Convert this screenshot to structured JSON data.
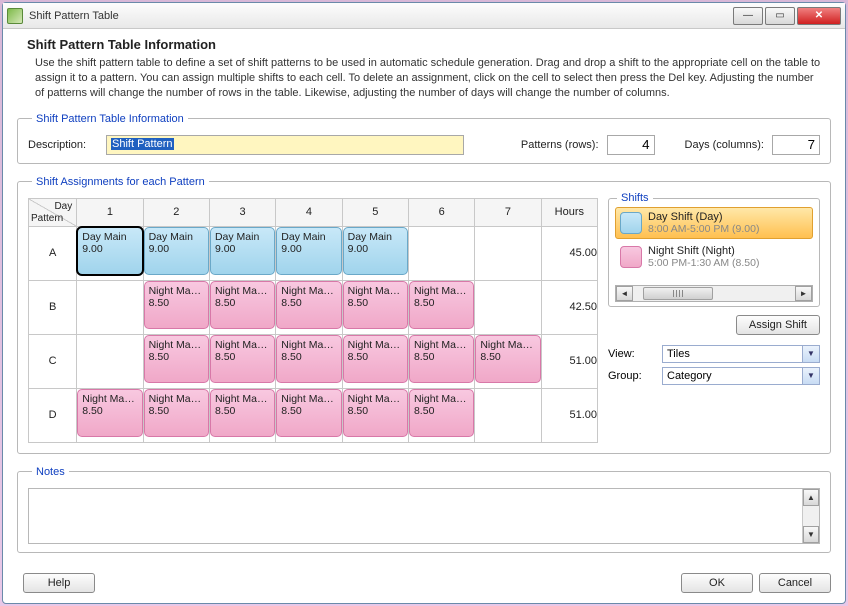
{
  "window": {
    "title": "Shift Pattern Table"
  },
  "header": {
    "title": "Shift Pattern Table Information",
    "desc": "Use the shift pattern table to define a set of shift patterns to be used in automatic schedule generation. Drag and drop a shift to the appropriate cell on the table to assign it to a pattern. You can assign multiple shifts to each cell. To delete an assignment, click on the cell to select then press the Del key.  Adjusting the number of patterns will change the number of rows in the table. Likewise, adjusting the number of days will change the number of columns."
  },
  "info": {
    "legend": "Shift Pattern Table Information",
    "desc_label": "Description:",
    "desc_value": "Shift Pattern",
    "patterns_label": "Patterns (rows):",
    "patterns_value": "4",
    "days_label": "Days (columns):",
    "days_value": "7"
  },
  "assign": {
    "legend": "Shift Assignments for each Pattern",
    "corner_day": "Day",
    "corner_pattern": "Pattern",
    "day_headers": [
      "1",
      "2",
      "3",
      "4",
      "5",
      "6",
      "7"
    ],
    "hours_header": "Hours",
    "rows": [
      {
        "label": "A",
        "hours": "45.00",
        "cells": [
          {
            "t": "day",
            "l1": "Day Main",
            "l2": "9.00",
            "sel": true
          },
          {
            "t": "day",
            "l1": "Day Main",
            "l2": "9.00"
          },
          {
            "t": "day",
            "l1": "Day Main",
            "l2": "9.00"
          },
          {
            "t": "day",
            "l1": "Day Main",
            "l2": "9.00"
          },
          {
            "t": "day",
            "l1": "Day Main",
            "l2": "9.00"
          },
          null,
          null
        ]
      },
      {
        "label": "B",
        "hours": "42.50",
        "cells": [
          null,
          {
            "t": "night",
            "l1": "Night Ma…",
            "l2": "8.50"
          },
          {
            "t": "night",
            "l1": "Night Ma…",
            "l2": "8.50"
          },
          {
            "t": "night",
            "l1": "Night Ma…",
            "l2": "8.50"
          },
          {
            "t": "night",
            "l1": "Night Ma…",
            "l2": "8.50"
          },
          {
            "t": "night",
            "l1": "Night Ma…",
            "l2": "8.50"
          },
          null
        ]
      },
      {
        "label": "C",
        "hours": "51.00",
        "cells": [
          null,
          {
            "t": "night",
            "l1": "Night Ma…",
            "l2": "8.50"
          },
          {
            "t": "night",
            "l1": "Night Ma…",
            "l2": "8.50"
          },
          {
            "t": "night",
            "l1": "Night Ma…",
            "l2": "8.50"
          },
          {
            "t": "night",
            "l1": "Night Ma…",
            "l2": "8.50"
          },
          {
            "t": "night",
            "l1": "Night Ma…",
            "l2": "8.50"
          },
          {
            "t": "night",
            "l1": "Night Ma…",
            "l2": "8.50"
          }
        ]
      },
      {
        "label": "D",
        "hours": "51.00",
        "cells": [
          {
            "t": "night",
            "l1": "Night Ma…",
            "l2": "8.50"
          },
          {
            "t": "night",
            "l1": "Night Ma…",
            "l2": "8.50"
          },
          {
            "t": "night",
            "l1": "Night Ma…",
            "l2": "8.50"
          },
          {
            "t": "night",
            "l1": "Night Ma…",
            "l2": "8.50"
          },
          {
            "t": "night",
            "l1": "Night Ma…",
            "l2": "8.50"
          },
          {
            "t": "night",
            "l1": "Night Ma…",
            "l2": "8.50"
          },
          null
        ]
      }
    ]
  },
  "shifts": {
    "legend": "Shifts",
    "items": [
      {
        "kind": "day",
        "title": "Day Shift (Day)",
        "sub": "8:00 AM-5:00 PM (9.00)",
        "selected": true
      },
      {
        "kind": "night",
        "title": "Night Shift (Night)",
        "sub": "5:00 PM-1:30 AM (8.50)",
        "selected": false
      }
    ],
    "assign_btn": "Assign Shift",
    "view_label": "View:",
    "view_value": "Tiles",
    "group_label": "Group:",
    "group_value": "Category"
  },
  "notes": {
    "legend": "Notes"
  },
  "footer": {
    "help": "Help",
    "ok": "OK",
    "cancel": "Cancel"
  }
}
